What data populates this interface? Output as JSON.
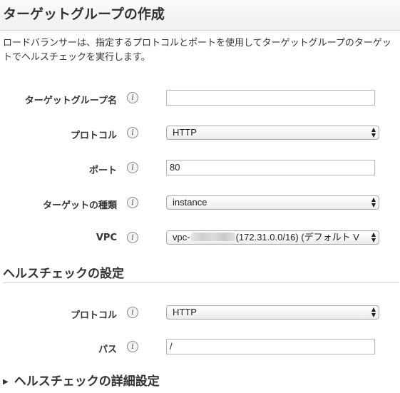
{
  "page": {
    "title": "ターゲットグループの作成",
    "description": "ロードバランサーは、指定するプロトコルとポートを使用してターゲットグループのターゲットでヘルスチェックを実行します。"
  },
  "form": {
    "target_group_name": {
      "label": "ターゲットグループ名",
      "value": ""
    },
    "protocol": {
      "label": "プロトコル",
      "value": "HTTP"
    },
    "port": {
      "label": "ポート",
      "value": "80"
    },
    "target_type": {
      "label": "ターゲットの種類",
      "value": "instance"
    },
    "vpc": {
      "label": "VPC",
      "value_prefix": "vpc-",
      "value_suffix": "(172.31.0.0/16) (デフォルト V"
    }
  },
  "health_check": {
    "title": "ヘルスチェックの設定",
    "protocol": {
      "label": "プロトコル",
      "value": "HTTP"
    },
    "path": {
      "label": "パス",
      "value": "/"
    },
    "advanced_label": "ヘルスチェックの詳細設定"
  },
  "icons": {
    "info": "i",
    "select_arrows_up": "▲",
    "select_arrows_down": "▼",
    "expand": "▶"
  }
}
